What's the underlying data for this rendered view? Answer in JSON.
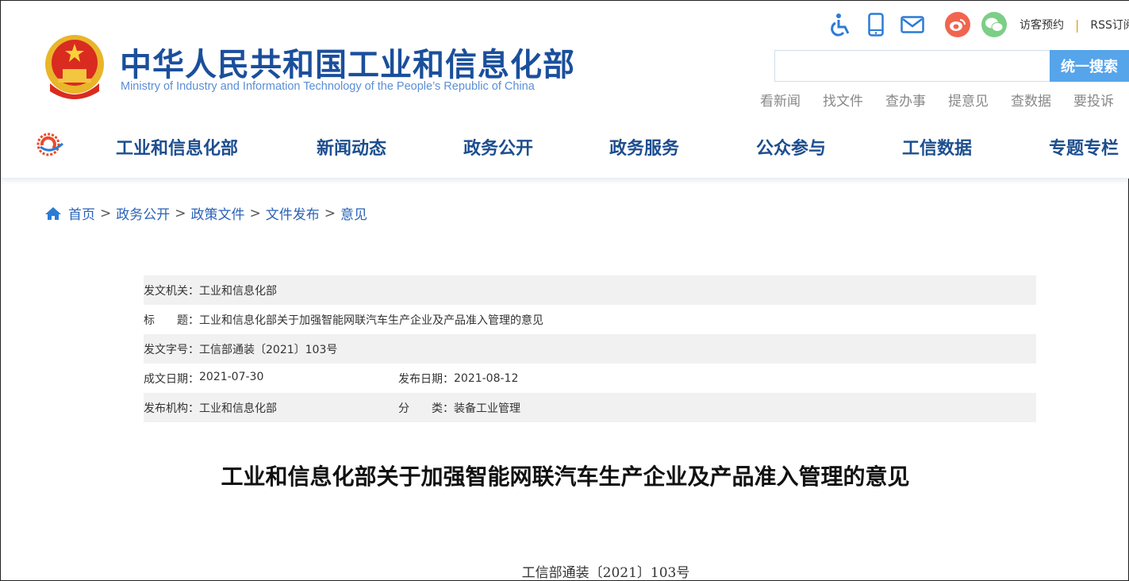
{
  "header": {
    "title": "中华人民共和国工业和信息化部",
    "subtitle": "Ministry of Industry and Information Technology of the People’s Republic of China",
    "top_links": [
      "访客预约",
      "RSS订阅"
    ],
    "search": {
      "placeholder": "",
      "button": "统一搜索"
    },
    "quick_links": [
      "看新闻",
      "找文件",
      "查办事",
      "提意见",
      "查数据",
      "要投诉"
    ]
  },
  "nav": [
    "工业和信息化部",
    "新闻动态",
    "政务公开",
    "政务服务",
    "公众参与",
    "工信数据",
    "专题专栏"
  ],
  "breadcrumb": [
    "首页",
    "政务公开",
    "政策文件",
    "文件发布",
    "意见"
  ],
  "info": {
    "issuer_label": "发文机关：",
    "issuer": "工业和信息化部",
    "title_label": "标　　题：",
    "title": "工业和信息化部关于加强智能网联汽车生产企业及产品准入管理的意见",
    "number_label": "发文字号：",
    "number": "工信部通装〔2021〕103号",
    "written_label": "成文日期：",
    "written": "2021-07-30",
    "published_label": "发布日期：",
    "published": "2021-08-12",
    "org_label": "发布机构：",
    "org": "工业和信息化部",
    "category_label": "分　　类：",
    "category": "装备工业管理"
  },
  "doc": {
    "title": "工业和信息化部关于加强智能网联汽车生产企业及产品准入管理的意见",
    "number": "工信部通装〔2021〕103号"
  },
  "colors": {
    "brand": "#1a4f9c",
    "accent": "#56a4ea",
    "weibo": "#f0654f",
    "wechat": "#7ccf86"
  }
}
